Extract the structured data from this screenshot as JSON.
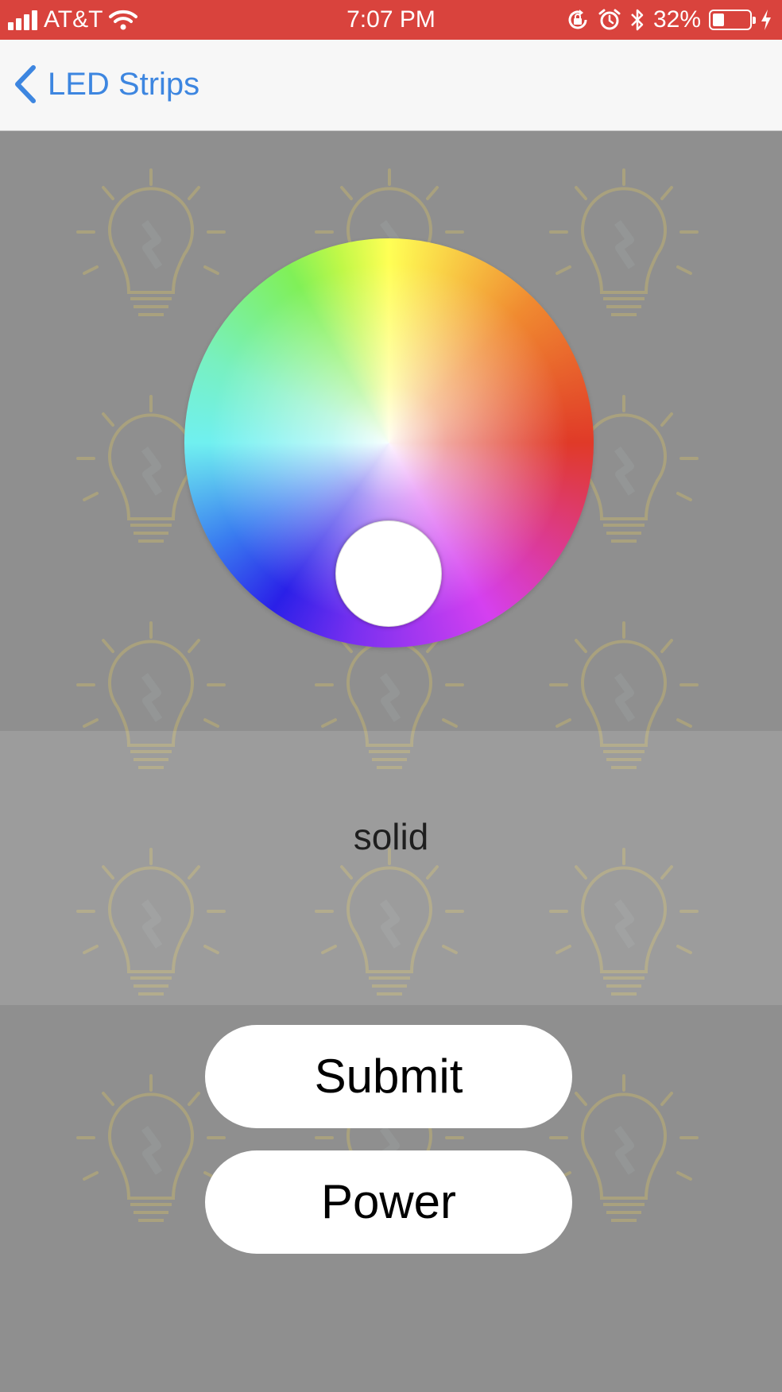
{
  "status_bar": {
    "carrier": "AT&T",
    "time": "7:07 PM",
    "battery_percent": "32%",
    "battery_level": 0.32,
    "background_color": "#d9433d"
  },
  "nav": {
    "back_label": "LED Strips",
    "accent_color": "#3d86e0"
  },
  "picker": {
    "selected_mode": "solid"
  },
  "buttons": {
    "submit_label": "Submit",
    "power_label": "Power"
  }
}
